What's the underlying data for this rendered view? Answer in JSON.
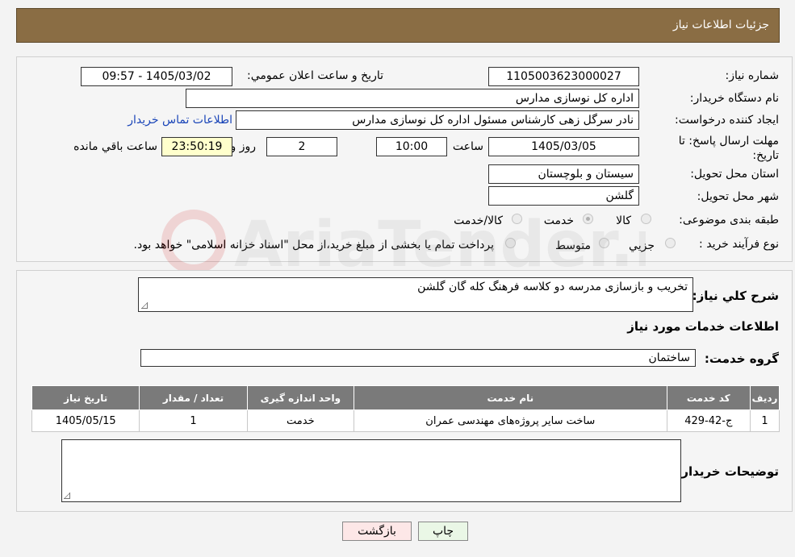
{
  "header": {
    "title": "جزئیات اطلاعات نیاز"
  },
  "form": {
    "need_number_label": "شماره نیاز:",
    "need_number": "1105003623000027",
    "announce_label": "تاريخ و ساعت اعلان عمومي:",
    "announce_value": "1405/03/02 - 09:57",
    "buyer_org_label": "نام دستگاه خريدار:",
    "buyer_org": "اداره کل نوسازی مدارس",
    "requester_label": "ايجاد کننده درخواست:",
    "requester": "نادر سرگل زهی کارشناس مسئول اداره کل نوسازی مدارس",
    "contact_link": "اطلاعات تماس خريدار",
    "deadline_label_1": "مهلت ارسال پاسخ: تا",
    "deadline_label_2": "تاريخ:",
    "deadline_date": "1405/03/05",
    "time_label": "ساعت",
    "deadline_time": "10:00",
    "days_value": "2",
    "days_label": "روز و",
    "remaining_time": "23:50:19",
    "remaining_label": "ساعت باقي مانده",
    "province_label": "استان محل تحويل:",
    "province": "سيستان و بلوچستان",
    "city_label": "شهر محل تحويل:",
    "city": "گلشن",
    "category_label": "طبقه بندی موضوعی:",
    "category_options": [
      "کالا",
      "خدمت",
      "کالا/خدمت"
    ],
    "category_selected": "خدمت",
    "process_label": "نوع فرآيند خريد :",
    "process_options": [
      "جزيي",
      "متوسط"
    ],
    "process_note": "پرداخت تمام يا بخشی از مبلغ خريد،از محل \"اسناد خزانه اسلامی\" خواهد بود."
  },
  "details": {
    "summary_label": "شرح کلي نياز:",
    "summary": "تخریب و بازسازی مدرسه دو کلاسه فرهنگ کله گان گلشن",
    "services_title": "اطلاعات خدمات مورد نياز",
    "service_group_label": "گروه خدمت:",
    "service_group": "ساختمان",
    "table_headers": [
      "رديف",
      "کد خدمت",
      "نام خدمت",
      "واحد اندازه گيری",
      "تعداد / مقدار",
      "تاريخ نياز"
    ],
    "table_rows": [
      [
        "1",
        "ج-42-429",
        "ساخت ساير پروژه‌های مهندسی عمران",
        "خدمت",
        "1",
        "1405/05/15"
      ]
    ],
    "buyer_notes_label": "توضيحات خريدار:",
    "buyer_notes": ""
  },
  "buttons": {
    "print": "چاپ",
    "back": "بازگشت"
  },
  "watermark": {
    "text": "AriaTender.neT"
  }
}
